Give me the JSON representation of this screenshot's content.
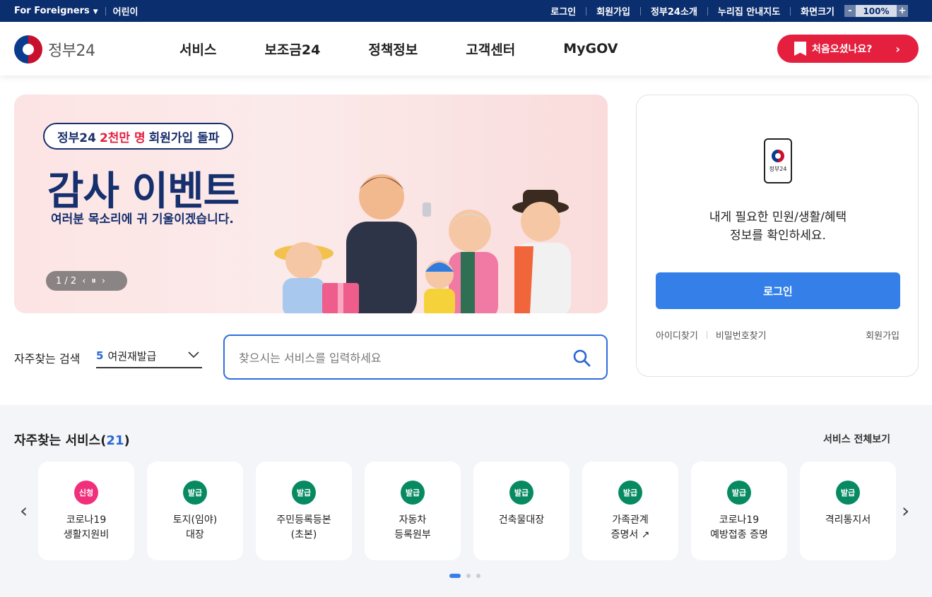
{
  "topbar": {
    "foreigners": "For Foreigners",
    "kids": "어린이",
    "links": [
      "로그인",
      "회원가입",
      "정부24소개",
      "누리집 안내지도",
      "화면크기"
    ],
    "zoom_minus": "-",
    "zoom_value": "100%",
    "zoom_plus": "+"
  },
  "header": {
    "logo_text": "정부24",
    "nav": [
      "서비스",
      "보조금24",
      "정책정보",
      "고객센터",
      "MyGOV"
    ],
    "cta": "처음오셨나요?"
  },
  "banner": {
    "pill_prefix": "정부24",
    "pill_highlight": "2천만 명",
    "pill_suffix": "회원가입 돌파",
    "headline": "감사 이벤트",
    "subline": "여러분 목소리에 귀 기울이겠습니다.",
    "pager": "1 / 2"
  },
  "search": {
    "frequent_label": "자주찾는 검색",
    "selected_num": "5",
    "selected_term": "여권재발급",
    "placeholder": "찾으시는 서비스를 입력하세요"
  },
  "login": {
    "phone_label": "정부24",
    "message_line1": "내게 필요한 민원/생활/혜택",
    "message_line2": "정보를 확인하세요.",
    "button": "로그인",
    "find_id": "아이디찾기",
    "find_pw": "비밀번호찾기",
    "signup": "회원가입"
  },
  "services": {
    "title": "자주찾는 서비스",
    "count": "21",
    "view_all": "서비스 전체보기",
    "items": [
      {
        "badge": "신청",
        "label": "코로나19\n생활지원비"
      },
      {
        "badge": "발급",
        "label": "토지(임야)\n대장"
      },
      {
        "badge": "발급",
        "label": "주민등록등본\n(초본)"
      },
      {
        "badge": "발급",
        "label": "자동차\n등록원부"
      },
      {
        "badge": "발급",
        "label": "건축물대장"
      },
      {
        "badge": "발급",
        "label": "가족관계\n증명서"
      },
      {
        "badge": "발급",
        "label": "코로나19\n예방접종 증명"
      },
      {
        "badge": "발급",
        "label": "격리통지서"
      }
    ]
  },
  "colors": {
    "topbar": "#0b2e6e",
    "accent_blue": "#3480e8",
    "cta_red": "#e5203f",
    "badge_apply": "#f0307a",
    "badge_issue": "#078a61"
  }
}
